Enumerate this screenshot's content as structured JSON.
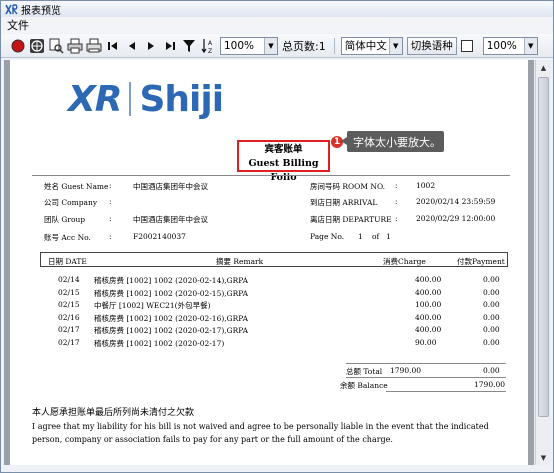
{
  "window": {
    "title": "报表预览"
  },
  "menu": {
    "file": "文件"
  },
  "toolbar": {
    "zoom_value": "100%",
    "total_pages": "总页数:1",
    "language_value": "简体中文",
    "switch_language": "切换语种",
    "zoom2_value": "100%"
  },
  "report": {
    "title_cn": "宾客账单",
    "title_en": "Guest Billing Folio",
    "callout_num": "1",
    "callout_text": "字体太小要放大。",
    "guest_name_label": "姓名 Guest Name",
    "guest_name_sep": ":",
    "guest_name": "中国酒店集团年中会议",
    "company_label": "公司 Company",
    "company_sep": ":",
    "group_label": "团队 Group",
    "group_sep": ":",
    "group": "中国酒店集团年中会议",
    "acc_label": "账号 Acc No.",
    "acc_sep": ":",
    "acc_no": "F2002140037",
    "room_label": "房间号码 ROOM NO.",
    "room_sep": ":",
    "room_no": "1002",
    "arrival_label": "到店日期 ARRIVAL",
    "arrival_sep": ":",
    "arrival": "2020/02/14 23:59:59",
    "departure_label": "离店日期 DEPARTURE",
    "departure_sep": ":",
    "departure": "2020/02/29 12:00:00",
    "page_label": "Page No.",
    "page_no": "1",
    "page_of": "of",
    "page_total": "1",
    "columns": {
      "date": "日期 DATE",
      "remark": "摘要 Remark",
      "charge": "消费Charge",
      "payment": "付款Payment"
    },
    "rows": [
      {
        "date": "02/14",
        "remark": "稽核房费   [1002] 1002 (2020-02-14),GRPA",
        "charge": "400.00",
        "payment": "0.00"
      },
      {
        "date": "02/15",
        "remark": "稽核房费   [1002] 1002 (2020-02-15),GRPA",
        "charge": "400.00",
        "payment": "0.00"
      },
      {
        "date": "02/15",
        "remark": "中餐厅   [1002] WEC21(外包早餐)",
        "charge": "100.00",
        "payment": "0.00"
      },
      {
        "date": "02/16",
        "remark": "稽核房费   [1002] 1002 (2020-02-16),GRPA",
        "charge": "400.00",
        "payment": "0.00"
      },
      {
        "date": "02/17",
        "remark": "稽核房费   [1002] 1002 (2020-02-17),GRPA",
        "charge": "400.00",
        "payment": "0.00"
      },
      {
        "date": "02/17",
        "remark": "稽核房费   [1002] 1002 (2020-02-17)",
        "charge": "90.00",
        "payment": "0.00"
      }
    ],
    "total_label": "总额  Total",
    "total_charge": "1790.00",
    "total_payment": "0.00",
    "balance_label": "余额  Balance",
    "balance": "1790.00",
    "disclaimer_title": "本人愿承担账单最后所列尚未清付之欠款",
    "disclaimer": "I agree that my liability for his bill is not waived and agree to be personally liable in the event that the indicated person, company or association fails to pay for any part or the full amount of the charge."
  },
  "logo": {
    "left": "XR",
    "right": "Shiji"
  },
  "icons": [
    "record-icon",
    "globe-icon",
    "print-preview-icon",
    "print-icon",
    "printer-icon",
    "first-page-icon",
    "prev-page-icon",
    "next-page-icon",
    "last-page-icon",
    "filter-icon",
    "sort-icon"
  ]
}
